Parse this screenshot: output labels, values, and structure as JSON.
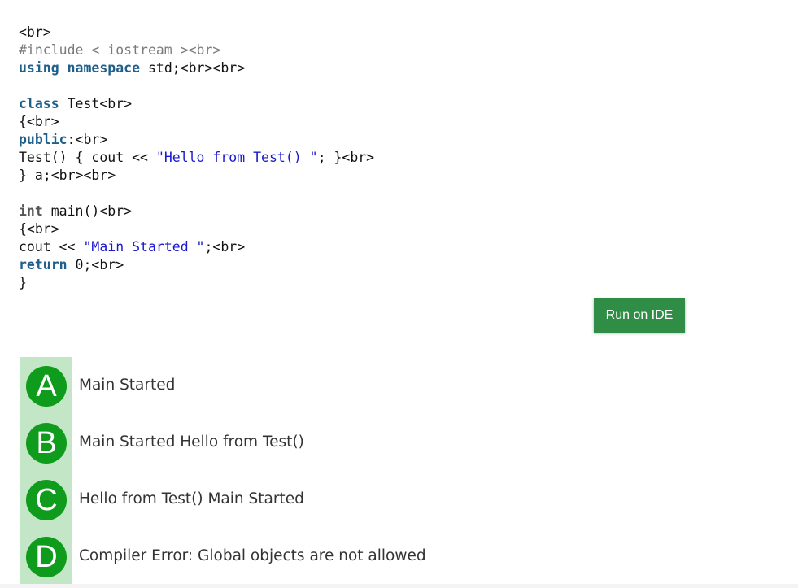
{
  "code": {
    "lines": [
      [
        {
          "t": "<br>",
          "c": ""
        }
      ],
      [
        {
          "t": "#include < iostream ><br>",
          "c": "pp"
        }
      ],
      [
        {
          "t": "using",
          "c": "kw"
        },
        {
          "t": " ",
          "c": ""
        },
        {
          "t": "namespace",
          "c": "kw"
        },
        {
          "t": " std;<br><br>",
          "c": ""
        }
      ],
      [
        {
          "t": "",
          "c": ""
        }
      ],
      [
        {
          "t": "class",
          "c": "kw"
        },
        {
          "t": " Test<br>",
          "c": ""
        }
      ],
      [
        {
          "t": "{<br>",
          "c": ""
        }
      ],
      [
        {
          "t": "public",
          "c": "kw"
        },
        {
          "t": ":<br>",
          "c": ""
        }
      ],
      [
        {
          "t": "Test() { cout << ",
          "c": ""
        },
        {
          "t": "\"Hello from Test() \"",
          "c": "str"
        },
        {
          "t": "; }<br>",
          "c": ""
        }
      ],
      [
        {
          "t": "} a;<br><br>",
          "c": ""
        }
      ],
      [
        {
          "t": "",
          "c": ""
        }
      ],
      [
        {
          "t": "int",
          "c": "type"
        },
        {
          "t": " main()<br>",
          "c": ""
        }
      ],
      [
        {
          "t": "{<br>",
          "c": ""
        }
      ],
      [
        {
          "t": "cout << ",
          "c": ""
        },
        {
          "t": "\"Main Started \"",
          "c": "str"
        },
        {
          "t": ";<br>",
          "c": ""
        }
      ],
      [
        {
          "t": "return",
          "c": "kw"
        },
        {
          "t": " 0;<br>",
          "c": ""
        }
      ],
      [
        {
          "t": "}",
          "c": ""
        }
      ]
    ]
  },
  "run_button": {
    "label": "Run on IDE"
  },
  "options": [
    {
      "letter": "A",
      "text": "Main Started"
    },
    {
      "letter": "B",
      "text": "Main Started Hello from Test()"
    },
    {
      "letter": "C",
      "text": "Hello from Test() Main Started"
    },
    {
      "letter": "D",
      "text": "Compiler Error: Global objects are not allowed"
    }
  ],
  "colors": {
    "accent": "#2f8d46",
    "badge": "#0f9b1b",
    "option_strip": "#c3e6c6",
    "keyword": "#1f5f8b",
    "string": "#1a1acc"
  }
}
